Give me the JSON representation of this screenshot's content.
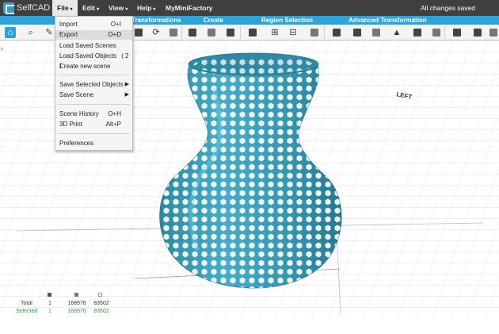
{
  "app": {
    "name": "SelfCAD"
  },
  "menu": {
    "file": "File",
    "edit": "Edit",
    "view": "View",
    "help": "Help",
    "myminifactory": "MyMiniFactory",
    "status": "All changes saved"
  },
  "sections": {
    "transformations": "Transformations",
    "create": "Create",
    "region_selection": "Region Selection",
    "advanced_transformation": "Advanced Transformation"
  },
  "file_menu": {
    "import": {
      "label": "Import",
      "shortcut": "O+I"
    },
    "export": {
      "label": "Export",
      "shortcut": "O+D"
    },
    "load_saved_scenes": "Load Saved Scenes",
    "load_saved_objects": "Load Saved Objects",
    "load_saved_objects_count": "( 2 )",
    "create_new_scene": "Create new scene",
    "save_selected_objects": "Save Selected Objects",
    "save_scene": "Save Scene",
    "scene_history": {
      "label": "Scene History",
      "shortcut": "O+H"
    },
    "print_3d": {
      "label": "3D Print",
      "shortcut": "Alt+P"
    },
    "preferences": "Preferences"
  },
  "viewport": {
    "axis_label": "LEFT",
    "model_color": "#3a9db8"
  },
  "stats": {
    "total_label": "Total",
    "selected_label": "Selected",
    "total": [
      "1",
      "168976",
      "83502"
    ],
    "selected": [
      "1",
      "168976",
      "83502"
    ],
    "selected_color": "#2e9f2e"
  },
  "colors": {
    "accent": "#2fa3d6",
    "menubar": "#3f3f3f"
  }
}
